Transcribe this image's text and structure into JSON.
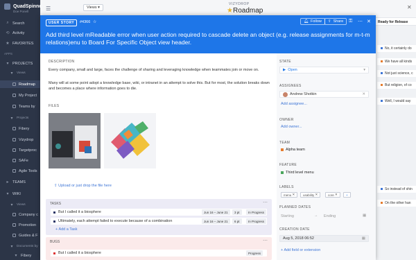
{
  "sidebar": {
    "workspace": "QuadSpinner",
    "user": "Doe Ponell",
    "search": "Search",
    "activity": "Activity",
    "favorites": "FAVORITES",
    "apps": "Apps",
    "projects": "PROJECTS",
    "views_hdr": "Views",
    "items": [
      "Roadmap",
      "My Project",
      "Teams by"
    ],
    "projects_hdr": "Projects",
    "proj_items": [
      "Fibery",
      "Vizydrop",
      "Targetproc",
      "SAFe",
      "Agile Tools"
    ],
    "teams": "TEAMS",
    "wiki": "WIKI",
    "views2_hdr": "Views",
    "wiki_items": [
      "Company c",
      "Promotion",
      "Guides & F"
    ],
    "documents_hdr": "Documents by",
    "fibery2": "Fibery"
  },
  "topbar": {
    "views": "Views",
    "app": "VIZYDROP",
    "title": "Roadmap"
  },
  "board": {
    "column": "Ready for Release",
    "cards": [
      {
        "text": "No, it certainly do",
        "color": "#3f76d6"
      },
      {
        "text": "We have all kinds",
        "color": "#e57c2e"
      },
      {
        "text": "Not just science, c",
        "color": "#3f76d6"
      },
      {
        "text": "But religion, of co",
        "color": "#e57c2e"
      },
      {
        "text": "Well, I would say",
        "color": "#3f76d6"
      },
      {
        "text": "So instead of shin",
        "color": "#3f76d6"
      },
      {
        "text": "On the other han",
        "color": "#e57c2e"
      }
    ]
  },
  "entity": {
    "type": "USER STORY",
    "id": "#4366",
    "title": "Add third level mReadable error when user action required to cascade delete an object (e.g. release assignments for m-t-m relations)enu to Board For Specific Object view header.",
    "follow": "Follow",
    "share": "Share",
    "description_label": "DESCRIPTION",
    "desc_p1": "Every company, small and large, faces the challenge of sharing and leveraging knowledge when teammates join or move on.",
    "desc_p2": "Many will at some point adopt a knowledge base, wiki, or intranet in an attempt to solve this. But for most, the solution breaks down and becomes a place where information goes to die.",
    "files_label": "FILES",
    "upload": "Upload or just drop the file here"
  },
  "tasks": {
    "label": "TASKS",
    "rows": [
      {
        "text": "But I called it a biosphere",
        "dates": "Jun 16 – June 21",
        "pts": "3 pt",
        "status": "In Progress"
      },
      {
        "text": "Ultimately, each attempt failed to execute because of a combination",
        "dates": "Jun 16 – June 21",
        "pts": "6 pt",
        "status": "In Progress"
      }
    ],
    "add": "Add a Task"
  },
  "bugs": {
    "label": "BUGS",
    "rows": [
      {
        "text": "But I called it a biosphere",
        "status": "Progress"
      }
    ]
  },
  "fields": {
    "state_label": "STATE",
    "state": "Open",
    "assignees_label": "ASSIGNEES",
    "assignee": "Andrew Shotkin",
    "add_assignee": "Add assignee...",
    "owner_label": "OWNER",
    "add_owner": "Add owner...",
    "team_label": "TEAM",
    "team": "Alpha team",
    "feature_label": "FEATURE",
    "feature": "Third level menu",
    "labels_label": "LABELS",
    "labels": [
      "menu",
      "usability",
      "core"
    ],
    "planned_label": "PLANNED DATES",
    "starting": "Starting",
    "ending": "Ending",
    "creation_label": "CREATION DATE",
    "creation": "Aug 5, 2018 06:52",
    "add_field": "Add field or extension"
  }
}
